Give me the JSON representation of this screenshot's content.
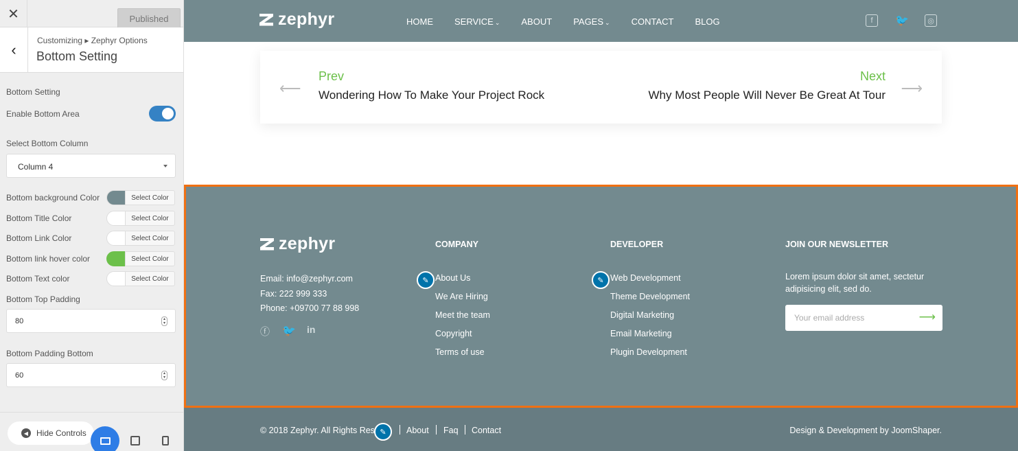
{
  "customizer": {
    "close_icon": "close-icon",
    "published_label": "Published",
    "breadcrumb": "Customizing ▸ Zephyr Options",
    "section_title": "Bottom Setting",
    "controls": {
      "group_label": "Bottom Setting",
      "enable_label": "Enable Bottom Area",
      "enable_value": true,
      "column_label": "Select Bottom Column",
      "column_value": "Column 4",
      "colors": [
        {
          "label": "Bottom background Color",
          "button": "Select Color",
          "value": "#738a8f"
        },
        {
          "label": "Bottom Title Color",
          "button": "Select Color",
          "value": "#ffffff"
        },
        {
          "label": "Bottom Link Color",
          "button": "Select Color",
          "value": "#ffffff"
        },
        {
          "label": "Bottom link hover color",
          "button": "Select Color",
          "value": "#6cc04a"
        },
        {
          "label": "Bottom Text color",
          "button": "Select Color",
          "value": "#ffffff"
        }
      ],
      "top_padding_label": "Bottom Top Padding",
      "top_padding_value": "80",
      "bottom_padding_label": "Bottom Padding Bottom",
      "bottom_padding_value": "60"
    },
    "hide_controls_label": "Hide Controls"
  },
  "site": {
    "logo_text": "zephyr",
    "nav": [
      "HOME",
      "SERVICE",
      "ABOUT",
      "PAGES",
      "CONTACT",
      "BLOG"
    ],
    "post_nav": {
      "prev_label": "Prev",
      "prev_title": "Wondering How To Make Your Project Rock",
      "next_label": "Next",
      "next_title": "Why Most People Will Never Be Great At Tour"
    },
    "footer": {
      "email": "Email: info@zephyr.com",
      "fax": "Fax: 222 999 333",
      "phone": "Phone: +09700 77 88 998",
      "company_heading": "COMPANY",
      "company_links": [
        "About Us",
        "We Are Hiring",
        "Meet the team",
        "Copyright",
        "Terms of use"
      ],
      "developer_heading": "DEVELOPER",
      "developer_links": [
        "Web Development",
        "Theme Development",
        "Digital Marketing",
        "Email Marketing",
        "Plugin Development"
      ],
      "newsletter_heading": "JOIN OUR NEWSLETTER",
      "newsletter_text_1": "Lorem ipsum dolor sit amet, sectetur",
      "newsletter_text_2": "adipisicing elit, sed do.",
      "email_placeholder": "Your email address"
    },
    "copyright": {
      "text": "© 2018 Zephyr. All Rights Rese",
      "links": [
        "About",
        "Faq",
        "Contact"
      ],
      "credit": "Design & Development by JoomShaper."
    }
  },
  "colors": {
    "accent_green": "#6cc04a",
    "header_bg": "#738a8f",
    "highlight_border": "#f07012",
    "wp_blue": "#0073aa"
  }
}
